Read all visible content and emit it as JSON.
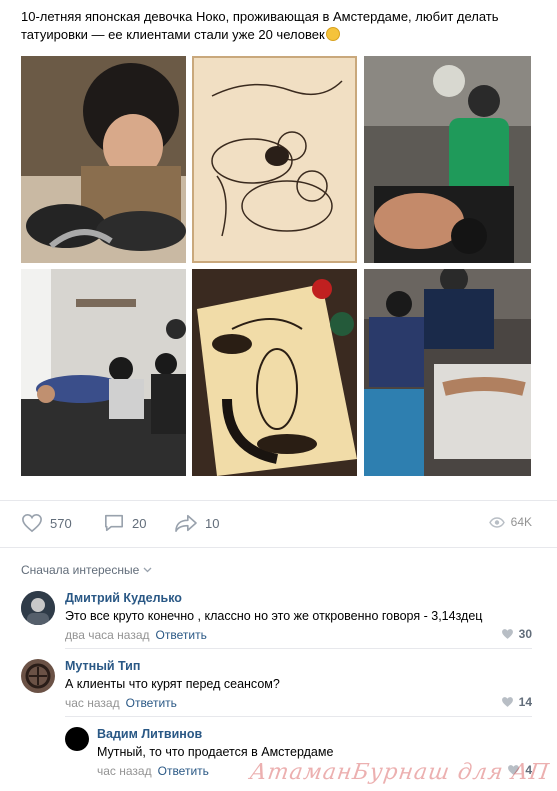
{
  "post": {
    "text": "10-летняя японская девочка Ноко, проживающая в Амстердаме, любит делать татуировки — ее клиентами стали уже 20 человек",
    "emoji_icon": "grinning-face-icon"
  },
  "photos": [
    "photo-girl-tattooing",
    "photo-cat-drawings",
    "photo-girl-green-shirt",
    "photo-tattoo-studio",
    "photo-bird-sketches",
    "photo-girl-with-client"
  ],
  "actions": {
    "likes": "570",
    "comments": "20",
    "shares": "10",
    "views": "64K"
  },
  "sort": {
    "label": "Сначала интересные"
  },
  "comments": [
    {
      "author": "Дмитрий Куделько",
      "text": "Это все круто конечно , классно но это же откровенно говоря - 3,14здец",
      "time": "два часа назад",
      "reply": "Ответить",
      "likes": "30"
    },
    {
      "author": "Мутный Тип",
      "text": "А клиенты что курят перед сеансом?",
      "time": "час назад",
      "reply": "Ответить",
      "likes": "14"
    },
    {
      "author": "Вадим Литвинов",
      "text": "Мутный, то что продается в Амстердаме",
      "time": "час назад",
      "reply": "Ответить",
      "likes": "4"
    }
  ],
  "watermark": "АтаманБурнаш для АП",
  "colors": {
    "link": "#2a5885",
    "secondary": "#939393",
    "icon": "#99a2ad"
  }
}
